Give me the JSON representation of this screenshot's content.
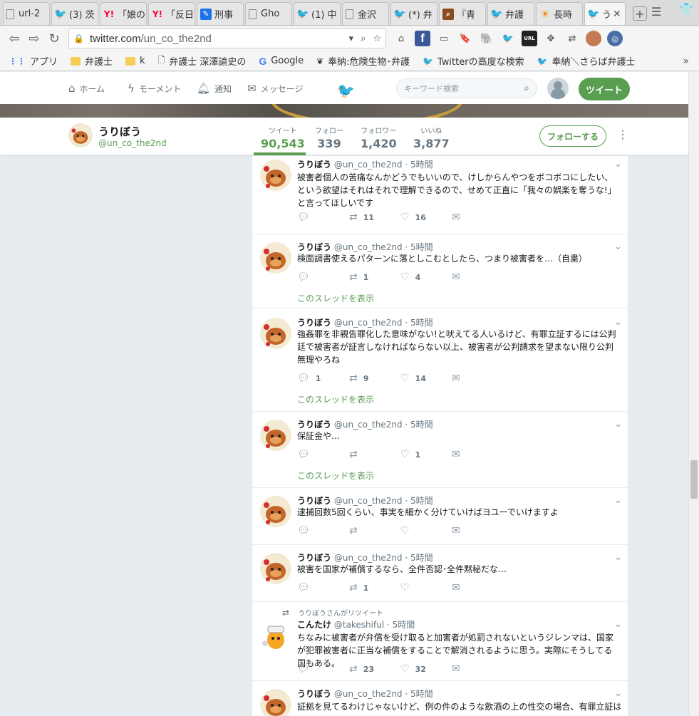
{
  "browser": {
    "tabs": [
      {
        "icon": "doc",
        "label": "url-2"
      },
      {
        "icon": "twitter",
        "label": "(3) 茨"
      },
      {
        "icon": "yahoo",
        "label": "「娘の"
      },
      {
        "icon": "yahoo",
        "label": "「反日"
      },
      {
        "icon": "blue",
        "label": "刑事"
      },
      {
        "icon": "doc",
        "label": "Gho"
      },
      {
        "icon": "twitter",
        "label": "(1) 中"
      },
      {
        "icon": "doc",
        "label": "金沢"
      },
      {
        "icon": "twitter",
        "label": "(*) 弁"
      },
      {
        "icon": "book",
        "label": "『青"
      },
      {
        "icon": "twitter",
        "label": "弁護"
      },
      {
        "icon": "sun",
        "label": "長時"
      },
      {
        "icon": "twitter",
        "label": "う"
      }
    ],
    "url_domain": "twitter.com",
    "url_path": "/un_co_the2nd",
    "bookmarks": [
      {
        "icon": "apps",
        "label": "アプリ"
      },
      {
        "icon": "folder",
        "label": "弁護士"
      },
      {
        "icon": "folder",
        "label": "k"
      },
      {
        "icon": "doc",
        "label": "弁護士 深澤諭史の"
      },
      {
        "icon": "google",
        "label": "Google"
      },
      {
        "icon": "bug",
        "label": "奉納:危険生物･弁護"
      },
      {
        "icon": "twitter",
        "label": "Twitterの高度な検索"
      },
      {
        "icon": "twitter",
        "label": "奉納＼さらば弁護士"
      }
    ]
  },
  "topnav": {
    "home": "ホーム",
    "moments": "モーメント",
    "notifications": "通知",
    "messages": "メッセージ",
    "search_placeholder": "キーワード検索",
    "tweet_button": "ツイート"
  },
  "profile": {
    "name": "うりぼう",
    "handle": "@un_co_the2nd",
    "stats": [
      {
        "label": "ツイート",
        "value": "90,543",
        "active": true
      },
      {
        "label": "フォロー",
        "value": "339"
      },
      {
        "label": "フォロワー",
        "value": "1,420"
      },
      {
        "label": "いいね",
        "value": "3,877"
      }
    ],
    "follow_button": "フォローする"
  },
  "thread_link": "このスレッドを表示",
  "tweets": [
    {
      "name": "うりぼう",
      "handle": "@un_co_the2nd",
      "time": "· 5時間",
      "text": "被害者個人の苦痛なんかどうでもいいので、けしからんやつをボコボコにしたい、という欲望はそれはそれで理解できるので、せめて正直に「我々の娯楽を奪うな!」と言ってほしいです",
      "replies": "",
      "retweets": "11",
      "likes": "16",
      "thread": false
    },
    {
      "name": "うりぼう",
      "handle": "@un_co_the2nd",
      "time": "· 5時間",
      "text": "検面調書使えるパターンに落としこむとしたら、つまり被害者を…（自粛）",
      "replies": "",
      "retweets": "1",
      "likes": "4",
      "thread": true
    },
    {
      "name": "うりぼう",
      "handle": "@un_co_the2nd",
      "time": "· 5時間",
      "text": "強姦罪を非親告罪化した意味がない!と吠えてる人いるけど、有罪立証するには公判廷で被害者が証言しなければならない以上、被害者が公判請求を望まない限り公判無理やろね",
      "replies": "1",
      "retweets": "9",
      "likes": "14",
      "thread": true
    },
    {
      "name": "うりぼう",
      "handle": "@un_co_the2nd",
      "time": "· 5時間",
      "text": "保証金や…",
      "replies": "",
      "retweets": "",
      "likes": "1",
      "thread": true
    },
    {
      "name": "うりぼう",
      "handle": "@un_co_the2nd",
      "time": "· 5時間",
      "text": "逮捕回数5回くらい、事実を細かく分けていけばヨユーでいけますよ",
      "replies": "",
      "retweets": "",
      "likes": "",
      "thread": false
    },
    {
      "name": "うりぼう",
      "handle": "@un_co_the2nd",
      "time": "· 5時間",
      "text": "被害を国家が補償するなら、全件否認･全件黙秘だな…",
      "replies": "",
      "retweets": "1",
      "likes": "",
      "thread": false
    },
    {
      "retweet_context": "うりぼうさんがリツイート",
      "name": "こんたけ",
      "handle": "@takeshiful",
      "time": "· 5時間",
      "text": "ちなみに被害者が弁償を受け取ると加害者が処罰されないというジレンマは、国家が犯罪被害者に正当な補償をすることで解消されるように思う。実際にそうしてる国もある。",
      "replies": "",
      "retweets": "23",
      "likes": "32",
      "thread": false
    },
    {
      "name": "うりぼう",
      "handle": "@un_co_the2nd",
      "time": "· 5時間",
      "text": "証拠を見てるわけじゃないけど、例の件のような飲酒の上の性交の場合、有罪立証は難",
      "replies": "",
      "retweets": "",
      "likes": "",
      "thread": false
    }
  ],
  "colors": {
    "accent": "#5a9e52",
    "twitter_blue": "#1da1f2",
    "page_bg": "#e6ecf0"
  }
}
